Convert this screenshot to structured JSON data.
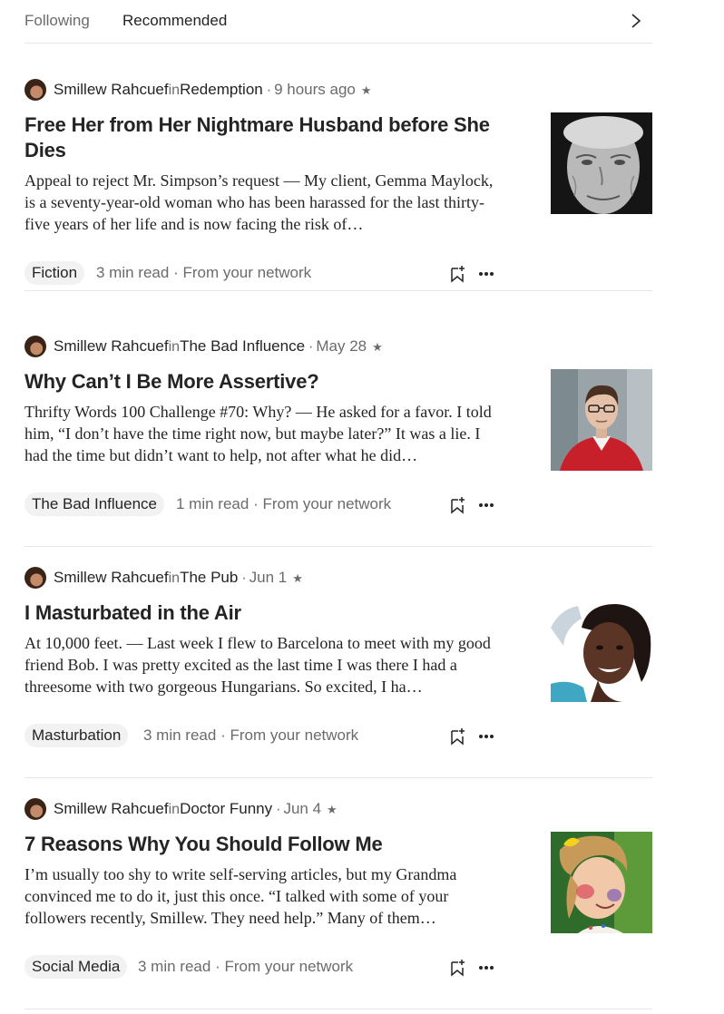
{
  "tabs": {
    "following": "Following",
    "recommended": "Recommended"
  },
  "articles": [
    {
      "author": "Smillew Rahcuef",
      "in_word": "in",
      "publication": "Redemption",
      "separator": "·",
      "date": "9 hours ago",
      "star": "★",
      "title": "Free Her from Her Nightmare Husband before She Dies",
      "excerpt": "Appeal to reject Mr. Simpson’s request — My client, Gemma Maylock, is a seventy-year-old woman who has been harassed for the last thirty-five years of her life and is now facing the risk of…",
      "tag": "Fiction",
      "read_time": "3 min read",
      "network": "From your network",
      "thumbnail": "elderly-woman-portrait"
    },
    {
      "author": "Smillew Rahcuef",
      "in_word": "in",
      "publication": "The Bad Influence",
      "separator": "·",
      "date": "May 28",
      "star": "★",
      "title": "Why Can’t I Be More Assertive?",
      "excerpt": "Thrifty Words 100 Challenge #70: Why? — He asked for a favor. I told him, “I don’t have the time right now, but maybe later?” It was a lie. I had the time but didn’t want to help, not after what he did…",
      "tag": "The Bad Influence",
      "read_time": "1 min read",
      "network": "From your network",
      "thumbnail": "man-in-red-sweater"
    },
    {
      "author": "Smillew Rahcuef",
      "in_word": "in",
      "publication": "The Pub",
      "separator": "·",
      "date": "Jun 1",
      "star": "★",
      "title": "I Masturbated in the Air",
      "excerpt": "At 10,000 feet. — Last week I flew to Barcelona to meet with my good friend Bob. I was pretty excited as the last time I was there I had a threesome with two gorgeous Hungarians. So excited, I ha…",
      "tag": "Masturbation",
      "read_time": "3 min read",
      "network": "From your network",
      "thumbnail": "smiling-woman-portrait"
    },
    {
      "author": "Smillew Rahcuef",
      "in_word": "in",
      "publication": "Doctor Funny",
      "separator": "·",
      "date": "Jun 4",
      "star": "★",
      "title": "7 Reasons Why You Should Follow Me",
      "excerpt": "I’m usually too shy to write self-serving articles, but my Grandma convinced me to do it, just this once. “I talked with some of your followers recently, Smillew. They need help.” Many of them…",
      "tag": "Social Media",
      "read_time": "3 min read",
      "network": "From your network",
      "thumbnail": "child-with-painted-face"
    }
  ],
  "icons": {
    "next": "chevron-right-icon",
    "bookmark": "bookmark-add-icon",
    "more": "more-horizontal-icon"
  }
}
